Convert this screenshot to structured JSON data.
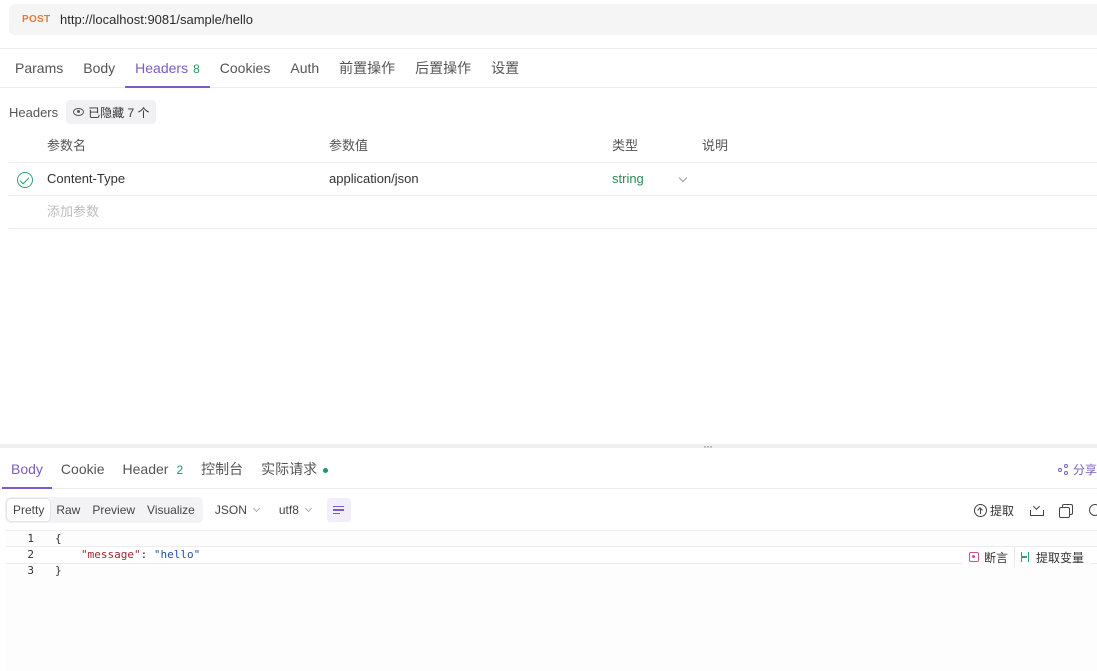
{
  "request": {
    "method": "POST",
    "url": "http://localhost:9081/sample/hello"
  },
  "request_tabs": [
    {
      "label": "Params"
    },
    {
      "label": "Body"
    },
    {
      "label": "Headers",
      "count": "8",
      "active": true
    },
    {
      "label": "Cookies"
    },
    {
      "label": "Auth"
    },
    {
      "label": "前置操作"
    },
    {
      "label": "后置操作"
    },
    {
      "label": "设置"
    }
  ],
  "headers_section": {
    "label": "Headers",
    "hidden_chip": "已隐藏 7 个"
  },
  "param_table": {
    "columns": [
      "参数名",
      "参数值",
      "类型",
      "说明"
    ],
    "rows": [
      {
        "name": "Content-Type",
        "value": "application/json",
        "type": "string",
        "description": "",
        "enabled": true
      }
    ],
    "add_placeholder": "添加参数"
  },
  "response_tabs": [
    {
      "label": "Body",
      "active": true
    },
    {
      "label": "Cookie"
    },
    {
      "label": "Header",
      "count": "2"
    },
    {
      "label": "控制台"
    },
    {
      "label": "实际请求",
      "dot": true
    }
  ],
  "share_label": "分享",
  "response_toolbar": {
    "view_modes": [
      "Pretty",
      "Raw",
      "Preview",
      "Visualize"
    ],
    "active_view": "Pretty",
    "format": "JSON",
    "encoding": "utf8",
    "extract_label": "提取"
  },
  "response_body": {
    "lines": [
      {
        "num": "1",
        "text": "{"
      },
      {
        "num": "2",
        "key": "\"message\"",
        "sep": ": ",
        "value": "\"hello\""
      },
      {
        "num": "3",
        "text": "}"
      }
    ],
    "inline_tools": {
      "assert_label": "断言",
      "extract_var_label": "提取变量"
    }
  },
  "colors": {
    "accent": "#7b5cc4",
    "method_post": "#e8793a",
    "success": "#1c9a5c",
    "json_key": "#a3242e",
    "json_string": "#1f4fa3"
  }
}
